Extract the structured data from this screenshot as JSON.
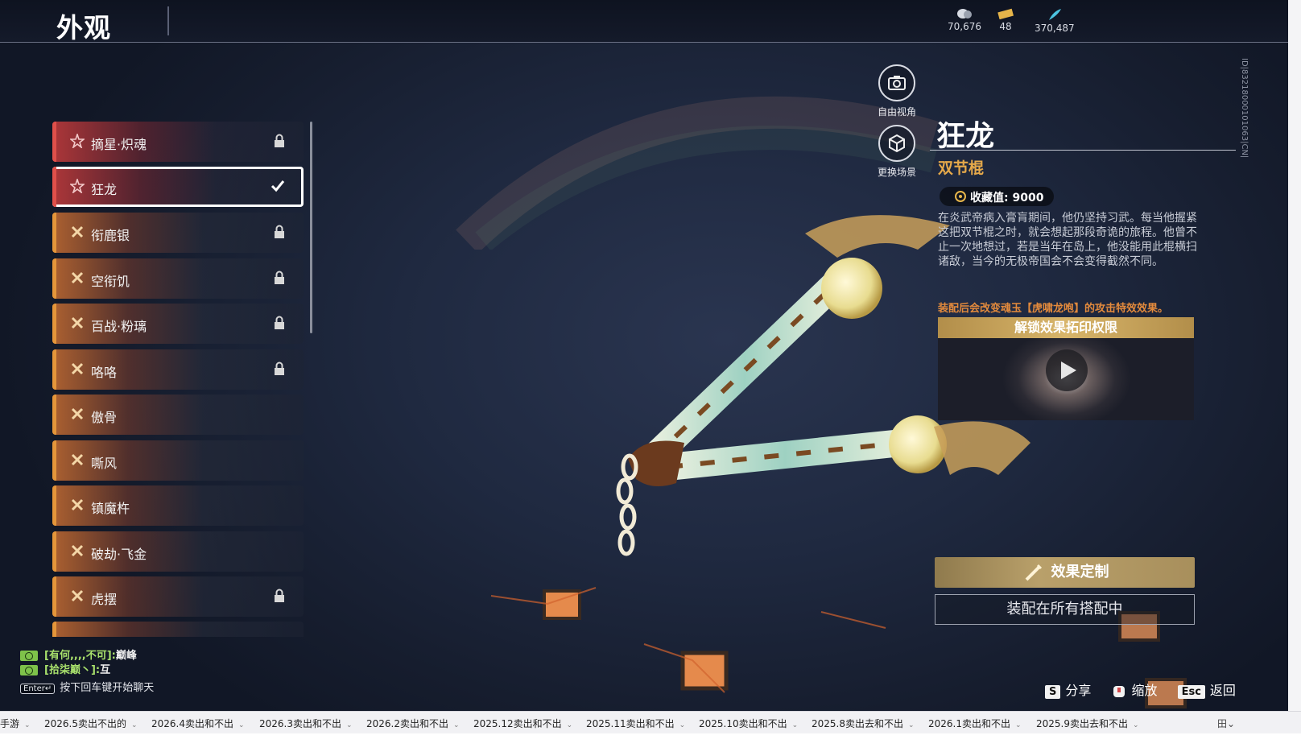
{
  "header": {
    "title": "外观"
  },
  "currencies": [
    {
      "icon": "coin-stack-icon",
      "value": "70,676"
    },
    {
      "icon": "ticket-icon",
      "value": "48"
    },
    {
      "icon": "feather-icon",
      "value": "370,487"
    }
  ],
  "skins": [
    {
      "label": "摘星·炽魂",
      "rarity": "red",
      "state": "locked"
    },
    {
      "label": "狂龙",
      "rarity": "red",
      "state": "selected"
    },
    {
      "label": "衔鹿银",
      "rarity": "orange",
      "state": "locked"
    },
    {
      "label": "空衔饥",
      "rarity": "orange",
      "state": "locked"
    },
    {
      "label": "百战·粉璃",
      "rarity": "orange",
      "state": "locked"
    },
    {
      "label": "咯咯",
      "rarity": "orange",
      "state": "locked"
    },
    {
      "label": "傲骨",
      "rarity": "orange",
      "state": "none"
    },
    {
      "label": "嘶风",
      "rarity": "orange",
      "state": "none"
    },
    {
      "label": "镇魔杵",
      "rarity": "orange",
      "state": "none"
    },
    {
      "label": "破劫·飞金",
      "rarity": "orange",
      "state": "none"
    },
    {
      "label": "虎摆",
      "rarity": "orange",
      "state": "locked"
    }
  ],
  "view_buttons": {
    "free_camera": "自由视角",
    "change_scene": "更换场景"
  },
  "detail": {
    "name": "狂龙",
    "type": "双节棍",
    "collection_label": "收藏值: 9000",
    "description": "在炎武帝病入膏肓期间，他仍坚持习武。每当他握紧这把双节棍之时，就会想起那段奇诡的旅程。他曾不止一次地想过，若是当年在岛上，他没能用此棍横扫诸敌，当今的无极帝国会不会变得截然不同。",
    "effect_note": "装配后会改变魂玉【虎啸龙咆】的攻击特效效果。",
    "unlock_title": "解锁效果拓印权限",
    "customize_label": "效果定制",
    "equip_label": "装配在所有搭配中"
  },
  "chat": {
    "lines": [
      {
        "name": "[有何,,,,不可]:",
        "msg": "巅峰"
      },
      {
        "name": "[拾柒巅丶]:",
        "msg": "互"
      }
    ],
    "enter_key": "Enter↵",
    "hint": "按下回车键开始聊天"
  },
  "hints": [
    {
      "key": "S",
      "label": "分享"
    },
    {
      "key": "",
      "label": "缩放"
    },
    {
      "key": "Esc",
      "label": "返回"
    }
  ],
  "version_id": "ID|83218000101063|CN|",
  "taskbar": {
    "items": [
      "手游",
      "2026.5卖出不出的",
      "2026.4卖出和不出",
      "2026.3卖出和不出",
      "2026.2卖出和不出",
      "2025.12卖出和不出",
      "2025.11卖出和不出",
      "2025.10卖出和不出",
      "2025.8卖出去和不出",
      "2026.1卖出和不出",
      "2025.9卖出去和不出"
    ],
    "right_label": "田"
  }
}
